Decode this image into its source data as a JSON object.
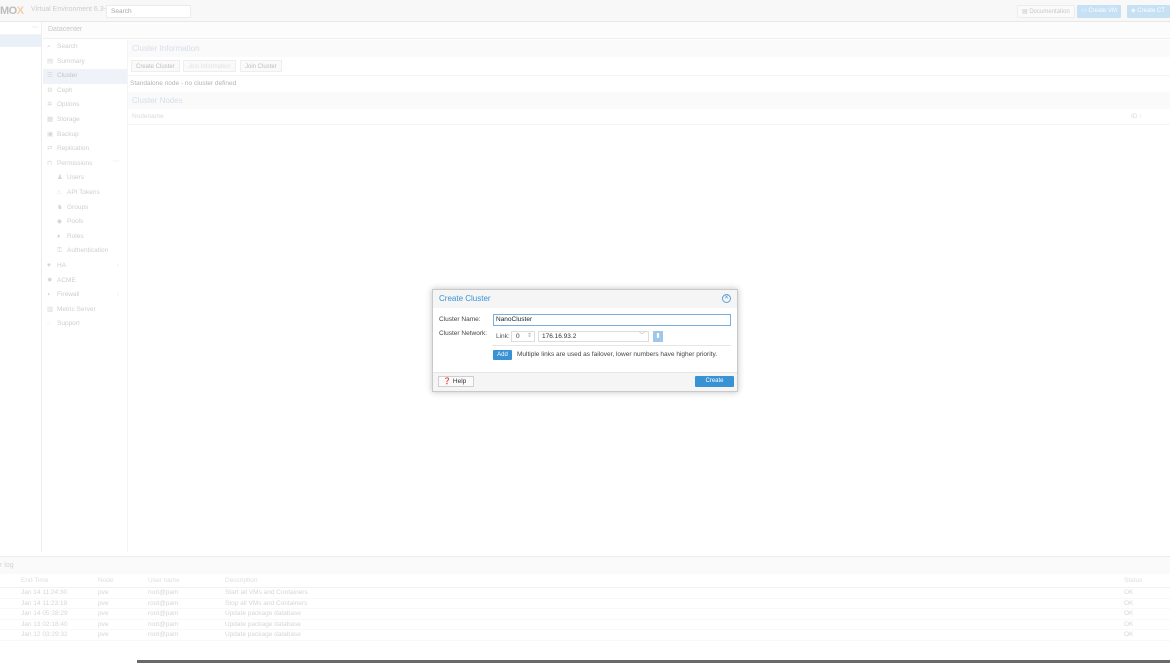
{
  "topbar": {
    "logo_main": "MO",
    "logo_x": "X",
    "version": "Virtual Environment 6.3-2",
    "search_placeholder": "Search",
    "documentation": "Documentation",
    "create_vm": "Create VM",
    "create_ct": "Create CT"
  },
  "breadcrumb": "Datacenter",
  "nav": {
    "items": [
      {
        "icon": "search-icon",
        "glyph": "⌕",
        "label": "Search"
      },
      {
        "icon": "book-icon",
        "glyph": "▤",
        "label": "Summary"
      },
      {
        "icon": "cluster-icon",
        "glyph": "☰",
        "label": "Cluster"
      },
      {
        "icon": "gear-icon",
        "glyph": "⚙",
        "label": "Ceph"
      },
      {
        "icon": "gear-icon",
        "glyph": "✲",
        "label": "Options"
      },
      {
        "icon": "database-icon",
        "glyph": "▦",
        "label": "Storage"
      },
      {
        "icon": "floppy-icon",
        "glyph": "▣",
        "label": "Backup"
      },
      {
        "icon": "retweet-icon",
        "glyph": "⇄",
        "label": "Replication"
      },
      {
        "icon": "unlock-icon",
        "glyph": "⊓",
        "label": "Permissions"
      },
      {
        "icon": "user-icon",
        "glyph": "♟",
        "label": "Users"
      },
      {
        "icon": "api-token-icon",
        "glyph": "⌂",
        "label": "API Tokens"
      },
      {
        "icon": "users-icon",
        "glyph": "♞",
        "label": "Groups"
      },
      {
        "icon": "tags-icon",
        "glyph": "◆",
        "label": "Pools"
      },
      {
        "icon": "male-icon",
        "glyph": "♦",
        "label": "Roles"
      },
      {
        "icon": "key-icon",
        "glyph": "⚿",
        "label": "Authentication"
      },
      {
        "icon": "heartbeat-icon",
        "glyph": "♥",
        "label": "HA"
      },
      {
        "icon": "certificate-icon",
        "glyph": "✹",
        "label": "ACME"
      },
      {
        "icon": "shield-icon",
        "glyph": "◗",
        "label": "Firewall"
      },
      {
        "icon": "bar-chart-icon",
        "glyph": "▥",
        "label": "Metric Server"
      },
      {
        "icon": "support-icon",
        "glyph": "◌",
        "label": "Support"
      }
    ]
  },
  "main": {
    "cluster_info_title": "Cluster Information",
    "btn_create_cluster": "Create Cluster",
    "btn_join_information": "Join Information",
    "btn_join_cluster": "Join Cluster",
    "standalone": "Standalone node - no cluster defined",
    "cluster_nodes_title": "Cluster Nodes",
    "col_nodename": "Nodename",
    "col_id": "ID ↑"
  },
  "dialog": {
    "title": "Create Cluster",
    "cluster_name_label": "Cluster Name:",
    "cluster_name_value": "NanoCluster",
    "cluster_network_label": "Cluster Network:",
    "link_label": "Link:",
    "link_value": "0",
    "address_value": "176.16.93.2",
    "add_label": "Add",
    "hint": "Multiple links are used as failover, lower numbers have higher priority.",
    "help_label": "Help",
    "create_label": "Create"
  },
  "log": {
    "title": "r log",
    "headers": {
      "end": "End Time",
      "node": "Node",
      "user": "User name",
      "desc": "Description",
      "status": "Status"
    },
    "rows": [
      {
        "end": "Jan 14 11:24:30",
        "node": "pve",
        "user": "root@pam",
        "desc": "Start all VMs and Containers",
        "status": "OK"
      },
      {
        "end": "Jan 14 11:23:19",
        "node": "pve",
        "user": "root@pam",
        "desc": "Stop all VMs and Containers",
        "status": "OK"
      },
      {
        "end": "Jan 14 05:28:29",
        "node": "pve",
        "user": "root@pam",
        "desc": "Update package database",
        "status": "OK"
      },
      {
        "end": "Jan 13 02:18:40",
        "node": "pve",
        "user": "root@pam",
        "desc": "Update package database",
        "status": "OK"
      },
      {
        "end": "Jan 12 03:29:32",
        "node": "pve",
        "user": "root@pam",
        "desc": "Update package database",
        "status": "OK"
      }
    ]
  },
  "colors": {
    "accent": "#3892d4",
    "accent_light": "#a8cfee"
  }
}
